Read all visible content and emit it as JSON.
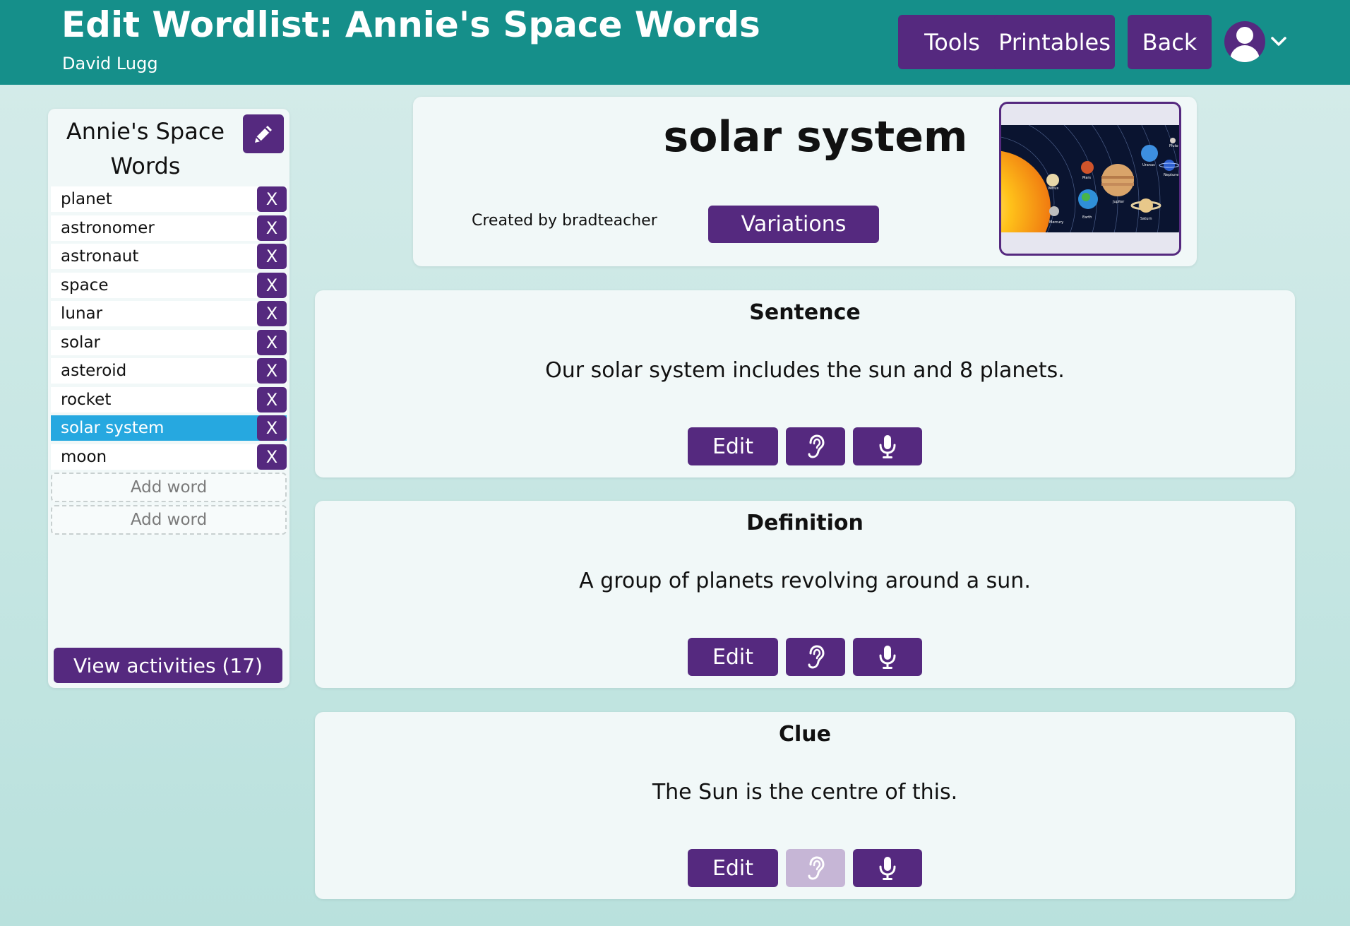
{
  "header": {
    "title": "Edit Wordlist: Annie's Space Words",
    "user": "David Lugg",
    "buttons": {
      "tools": "Tools",
      "printables": "Printables",
      "back": "Back"
    }
  },
  "sidebar": {
    "title": "Annie's Space Words",
    "words": [
      {
        "label": "planet",
        "remove": "X",
        "selected": false
      },
      {
        "label": "astronomer",
        "remove": "X",
        "selected": false
      },
      {
        "label": "astronaut",
        "remove": "X",
        "selected": false
      },
      {
        "label": "space",
        "remove": "X",
        "selected": false
      },
      {
        "label": "lunar",
        "remove": "X",
        "selected": false
      },
      {
        "label": "solar",
        "remove": "X",
        "selected": false
      },
      {
        "label": "asteroid",
        "remove": "X",
        "selected": false
      },
      {
        "label": "rocket",
        "remove": "X",
        "selected": false
      },
      {
        "label": "solar system",
        "remove": "X",
        "selected": true
      },
      {
        "label": "moon",
        "remove": "X",
        "selected": false
      }
    ],
    "add_word_placeholders": [
      "Add word",
      "Add word"
    ],
    "view_activities": "View activities (17)"
  },
  "word_card": {
    "word": "solar system",
    "created_by": "Created by bradteacher",
    "variations_label": "Variations",
    "image_labels": [
      "Venus",
      "Mars",
      "Jupiter",
      "Uranus",
      "Neptune",
      "Pluto",
      "Mercury",
      "Earth",
      "Saturn"
    ]
  },
  "sections": [
    {
      "title": "Sentence",
      "text": "Our solar system includes the sun and 8 planets.",
      "edit_label": "Edit",
      "listen_enabled": true
    },
    {
      "title": "Definition",
      "text": "A group of planets revolving around a sun.",
      "edit_label": "Edit",
      "listen_enabled": true
    },
    {
      "title": "Clue",
      "text": "The Sun is the centre of this.",
      "edit_label": "Edit",
      "listen_enabled": false
    }
  ],
  "colors": {
    "header": "#158f8a",
    "button": "#55297f",
    "selected_word": "#26a8e0",
    "disabled_button": "#c6b6d6"
  },
  "icons": [
    "pencil-icon",
    "user-icon",
    "chevron-down-icon",
    "ear-icon",
    "microphone-icon"
  ]
}
